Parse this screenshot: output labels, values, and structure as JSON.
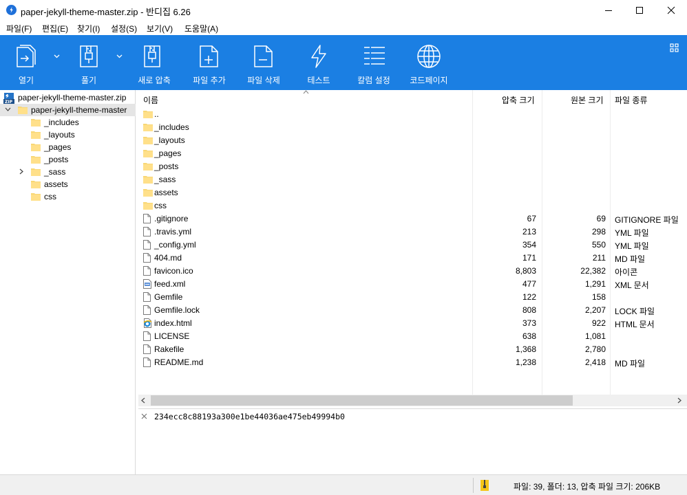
{
  "window": {
    "title": "paper-jekyll-theme-master.zip - 반디집 6.26"
  },
  "menu": [
    {
      "label": "파일(F)"
    },
    {
      "label": "편집(E)"
    },
    {
      "label": "찾기(I)"
    },
    {
      "label": "설정(S)"
    },
    {
      "label": "보기(V)"
    },
    {
      "label": "도움말(A)"
    }
  ],
  "toolbar": {
    "open": "열기",
    "extract": "풀기",
    "new_archive": "새로 압축",
    "add_file": "파일 추가",
    "delete_file": "파일 삭제",
    "test": "테스트",
    "columns": "칼럼 설정",
    "codepage": "코드페이지",
    "color": "#1b7fe3"
  },
  "tree": {
    "root": "paper-jekyll-theme-master.zip",
    "folder": "paper-jekyll-theme-master",
    "children": [
      {
        "label": "_includes"
      },
      {
        "label": "_layouts"
      },
      {
        "label": "_pages"
      },
      {
        "label": "_posts"
      },
      {
        "label": "_sass"
      },
      {
        "label": "assets"
      },
      {
        "label": "css"
      }
    ]
  },
  "columns": {
    "name": "이름",
    "compressed": "압축 크기",
    "original": "원본 크기",
    "type": "파일 종류"
  },
  "rows": [
    {
      "name": "..",
      "icon": "folder-icon",
      "csize": "",
      "osize": "",
      "type": ""
    },
    {
      "name": "_includes",
      "icon": "folder-icon",
      "csize": "",
      "osize": "",
      "type": ""
    },
    {
      "name": "_layouts",
      "icon": "folder-icon",
      "csize": "",
      "osize": "",
      "type": ""
    },
    {
      "name": "_pages",
      "icon": "folder-icon",
      "csize": "",
      "osize": "",
      "type": ""
    },
    {
      "name": "_posts",
      "icon": "folder-icon",
      "csize": "",
      "osize": "",
      "type": ""
    },
    {
      "name": "_sass",
      "icon": "folder-icon",
      "csize": "",
      "osize": "",
      "type": ""
    },
    {
      "name": "assets",
      "icon": "folder-icon",
      "csize": "",
      "osize": "",
      "type": ""
    },
    {
      "name": "css",
      "icon": "folder-icon",
      "csize": "",
      "osize": "",
      "type": ""
    },
    {
      "name": ".gitignore",
      "icon": "file-icon",
      "csize": "67",
      "osize": "69",
      "type": "GITIGNORE 파일"
    },
    {
      "name": ".travis.yml",
      "icon": "file-icon",
      "csize": "213",
      "osize": "298",
      "type": "YML 파일"
    },
    {
      "name": "_config.yml",
      "icon": "file-icon",
      "csize": "354",
      "osize": "550",
      "type": "YML 파일"
    },
    {
      "name": "404.md",
      "icon": "file-icon",
      "csize": "171",
      "osize": "211",
      "type": "MD 파일"
    },
    {
      "name": "favicon.ico",
      "icon": "file-icon",
      "csize": "8,803",
      "osize": "22,382",
      "type": "아이콘"
    },
    {
      "name": "feed.xml",
      "icon": "xml-file-icon",
      "csize": "477",
      "osize": "1,291",
      "type": "XML 문서"
    },
    {
      "name": "Gemfile",
      "icon": "file-icon",
      "csize": "122",
      "osize": "158",
      "type": ""
    },
    {
      "name": "Gemfile.lock",
      "icon": "file-icon",
      "csize": "808",
      "osize": "2,207",
      "type": "LOCK 파일"
    },
    {
      "name": "index.html",
      "icon": "html-file-icon",
      "csize": "373",
      "osize": "922",
      "type": "HTML 문서"
    },
    {
      "name": "LICENSE",
      "icon": "file-icon",
      "csize": "638",
      "osize": "1,081",
      "type": ""
    },
    {
      "name": "Rakefile",
      "icon": "file-icon",
      "csize": "1,368",
      "osize": "2,780",
      "type": ""
    },
    {
      "name": "README.md",
      "icon": "file-icon",
      "csize": "1,238",
      "osize": "2,418",
      "type": "MD 파일"
    }
  ],
  "comment": "234ecc8c88193a300e1be44036ae475eb49994b0",
  "status": "파일: 39, 폴더: 13, 압축 파일 크기: 206KB"
}
